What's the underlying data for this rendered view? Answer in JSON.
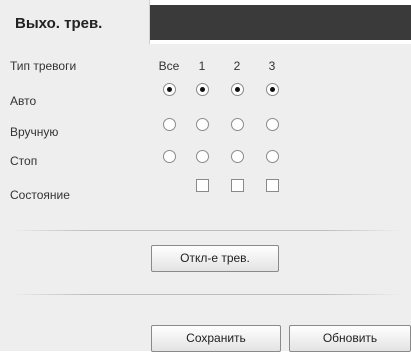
{
  "tab": {
    "label": "Выхо. трев."
  },
  "grid": {
    "columns": [
      "Все",
      "1",
      "2",
      "3"
    ],
    "rows": [
      {
        "label": "Тип тревоги"
      },
      {
        "label": "Авто",
        "selected": [
          true,
          true,
          true,
          true
        ]
      },
      {
        "label": "Вручную",
        "selected": [
          false,
          false,
          false,
          false
        ]
      },
      {
        "label": "Стоп",
        "selected": [
          false,
          false,
          false,
          false
        ]
      },
      {
        "label": "Состояние",
        "checked": [
          false,
          false,
          false
        ]
      }
    ]
  },
  "buttons": {
    "alarm_off": "Откл-е трев.",
    "save": "Сохранить",
    "refresh": "Обновить"
  }
}
